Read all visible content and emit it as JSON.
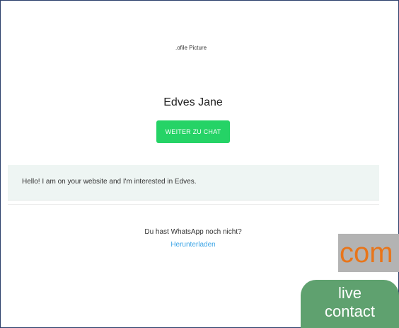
{
  "profile": {
    "picture_alt": ".ofile Picture",
    "name": "Edves Jane"
  },
  "chat_button": {
    "label": "WEITER ZU CHAT"
  },
  "message": {
    "text": "Hello! I am on your website and I'm interested in Edves."
  },
  "download": {
    "prompt": "Du hast WhatsApp noch nicht?",
    "link_label": "Herunterladen"
  },
  "overlay": {
    "com_text": "com",
    "live_contact_line1": "live",
    "live_contact_line2": "contact"
  },
  "colors": {
    "button_green": "#25d366",
    "message_bg": "#eef5f3",
    "link_blue": "#3ba4e6",
    "widget_green": "#5fa16f",
    "com_orange": "#e8751a",
    "com_bg": "#b3b3b3"
  }
}
